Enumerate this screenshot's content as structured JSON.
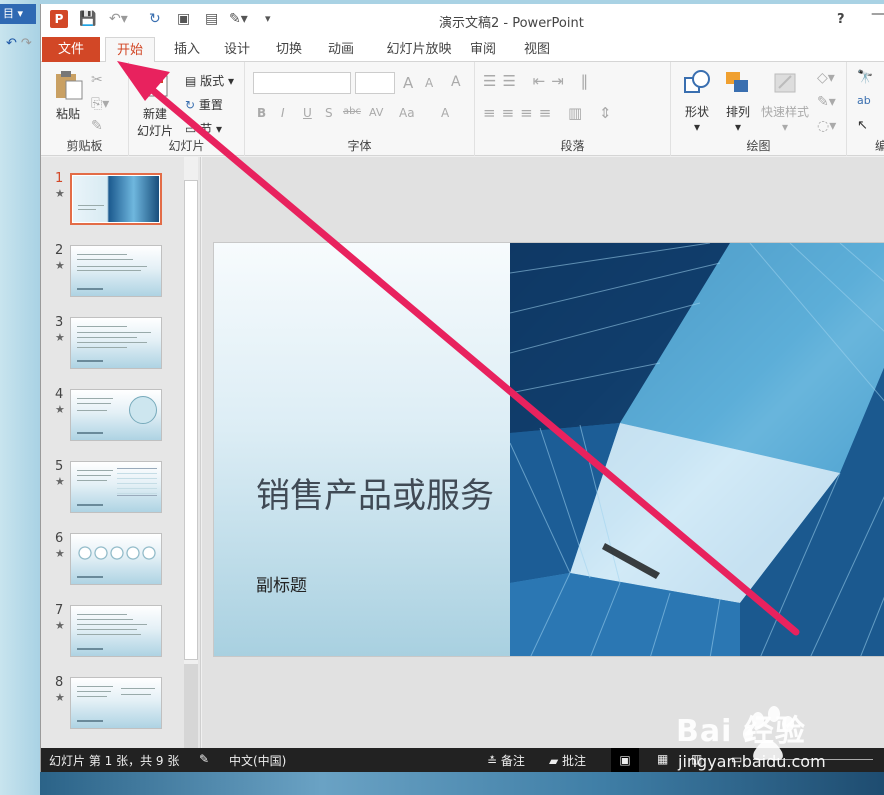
{
  "app": {
    "window_title": "演示文稿2 - PowerPoint",
    "help": "?",
    "minimize": "—",
    "logo_letter": "P"
  },
  "desktop": {
    "taskbar_label": "目 ▾"
  },
  "tabs": [
    "文件",
    "开始",
    "插入",
    "设计",
    "切换",
    "动画",
    "幻灯片放映",
    "审阅",
    "视图"
  ],
  "ribbon": {
    "clipboard": {
      "label": "剪贴板",
      "paste": "粘贴"
    },
    "slides": {
      "label": "幻灯片",
      "new_slide_line1": "新建",
      "new_slide_line2": "幻灯片",
      "layout": "版式",
      "reset": "重置",
      "section": "节"
    },
    "font": {
      "label": "字体",
      "bold": "B",
      "italic": "I",
      "underline": "U",
      "shadow": "S",
      "strike": "abc",
      "spacing": "AV",
      "case": "Aa",
      "clear": "A",
      "grow": "A",
      "shrink": "A",
      "color": "A"
    },
    "paragraph": {
      "label": "段落"
    },
    "drawing": {
      "label": "绘图",
      "shape": "形状",
      "arrange": "排列",
      "quick_styles": "快速样式"
    },
    "editing": {
      "label": "编"
    }
  },
  "thumbnails": [
    {
      "num": "1",
      "star": "★"
    },
    {
      "num": "2",
      "star": "★"
    },
    {
      "num": "3",
      "star": "★"
    },
    {
      "num": "4",
      "star": "★"
    },
    {
      "num": "5",
      "star": "★"
    },
    {
      "num": "6",
      "star": "★"
    },
    {
      "num": "7",
      "star": "★"
    },
    {
      "num": "8",
      "star": "★"
    }
  ],
  "slide": {
    "title": "销售产品或服务",
    "subtitle": "副标题"
  },
  "status": {
    "slide_info": "幻灯片 第 1 张，共 9 张",
    "language": "中文(中国)",
    "notes": "备注",
    "comments": "批注"
  },
  "watermark": {
    "text": "Bai 经验",
    "url": "jingyan.baidu.com"
  },
  "colors": {
    "accent": "#d24726",
    "arrow": "#e8225e"
  }
}
